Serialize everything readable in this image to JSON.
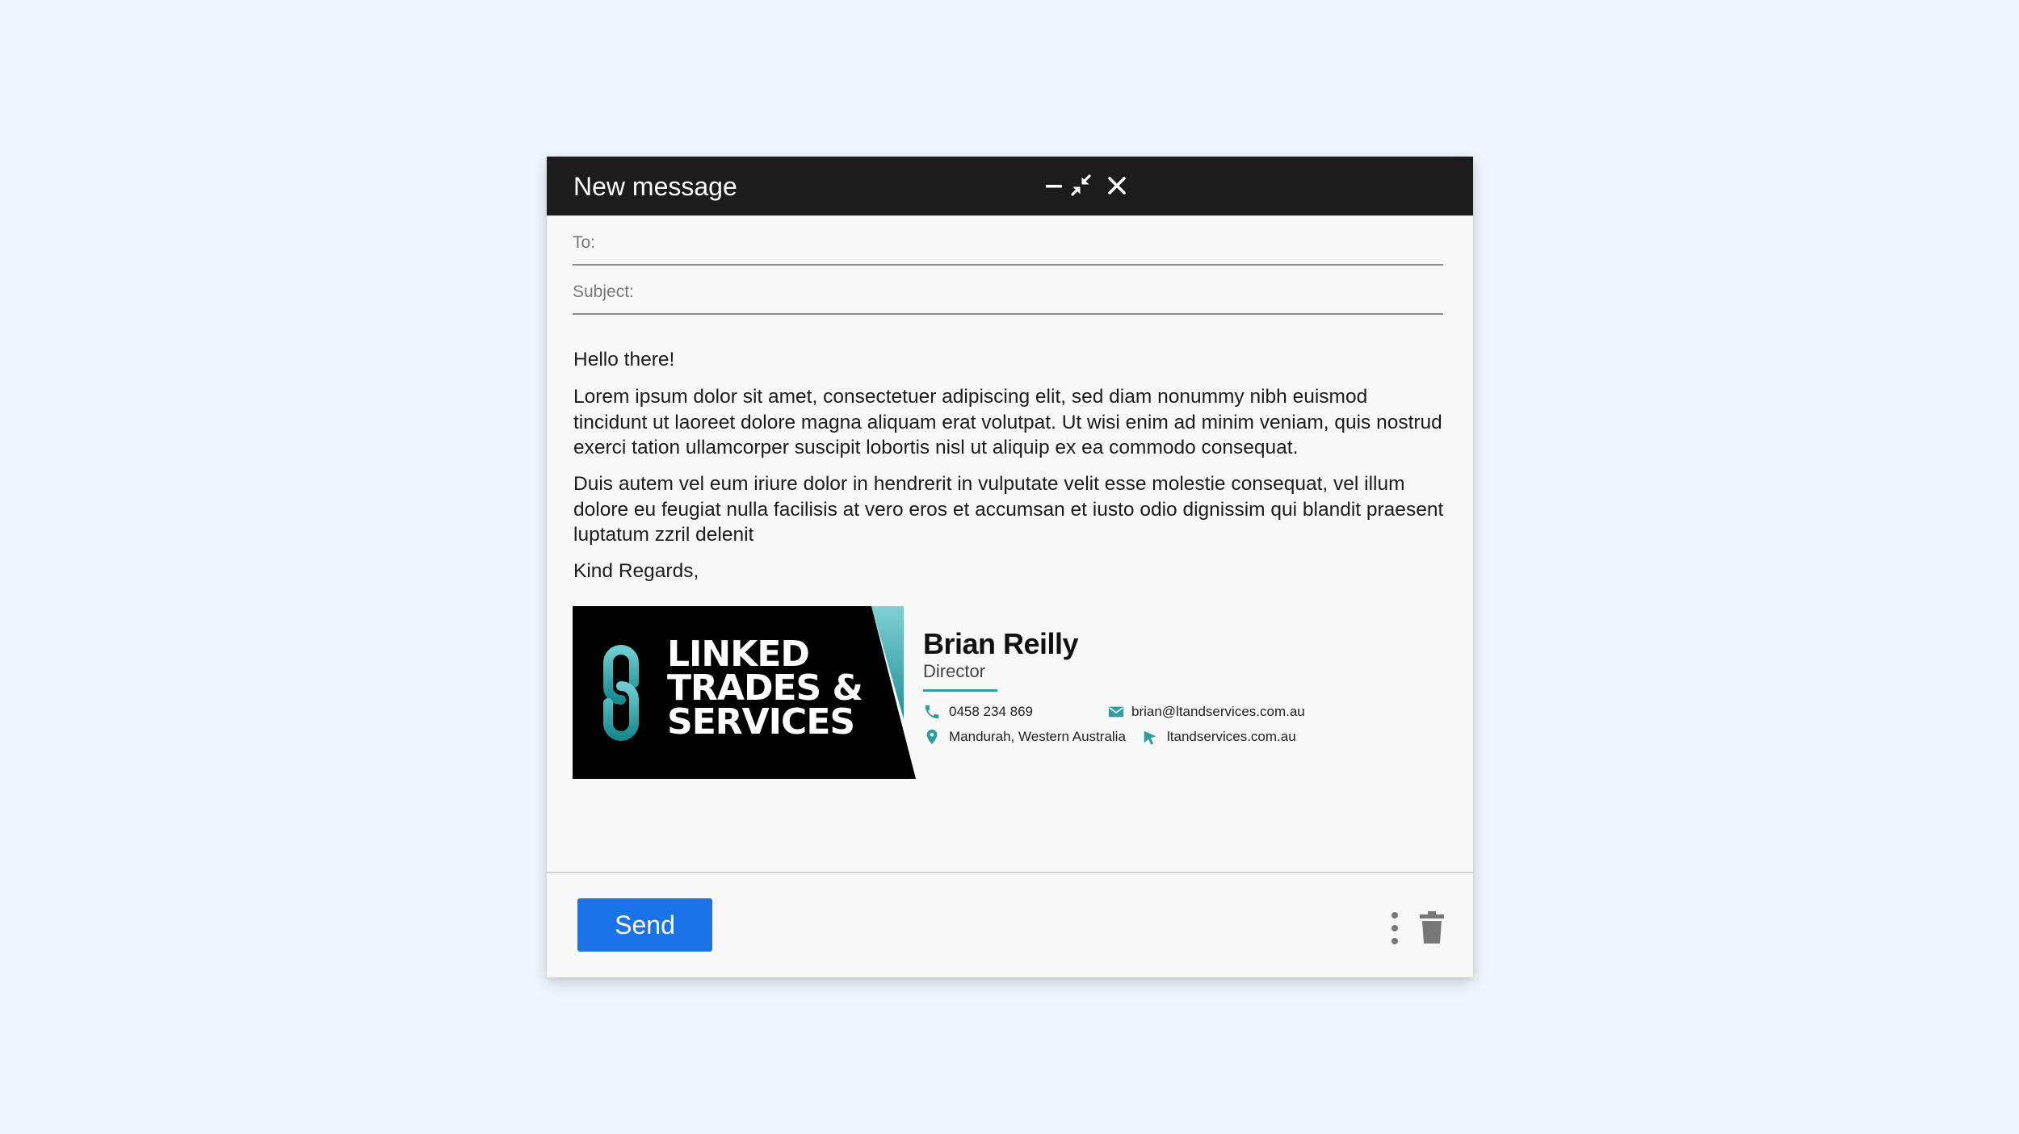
{
  "compose": {
    "title": "New message",
    "to_label": "To:",
    "subject_label": "Subject:",
    "to_value": "",
    "subject_value": "",
    "body": {
      "greeting": "Hello there!",
      "paragraph1": "Lorem ipsum dolor sit amet, consectetuer adipiscing elit, sed diam nonummy nibh euismod tincidunt ut laoreet dolore magna aliquam erat volutpat. Ut wisi enim ad minim veniam, quis nostrud exerci tation ullamcorper suscipit lobortis nisl ut aliquip ex ea commodo consequat.",
      "paragraph2": "Duis autem vel eum iriure dolor in hendrerit in vulputate velit esse molestie consequat, vel illum dolore eu feugiat nulla facilisis at vero eros et accumsan et iusto odio dignissim qui blandit praesent luptatum zzril delenit",
      "closing": "Kind Regards,"
    },
    "send_label": "Send"
  },
  "signature": {
    "logo_lines": [
      "LINKED",
      "TRADES &",
      "SERVICES"
    ],
    "name": "Brian Reilly",
    "role": "Director",
    "phone": "0458 234 869",
    "email": "brian@ltandservices.com.au",
    "location": "Mandurah, Western Australia",
    "website": "ltandservices.com.au"
  },
  "icons": {
    "window_controls": [
      "minimize-icon",
      "collapse-icon",
      "close-icon"
    ],
    "contact": [
      "phone-icon",
      "mail-icon",
      "location-pin-icon",
      "cursor-icon"
    ],
    "footer": [
      "more-options-icon",
      "trash-icon"
    ]
  },
  "colors": {
    "accent": "#2e9ea2",
    "send_button": "#1a73e8",
    "titlebar": "#1c1c1c",
    "page_background": "#eff6fd"
  }
}
